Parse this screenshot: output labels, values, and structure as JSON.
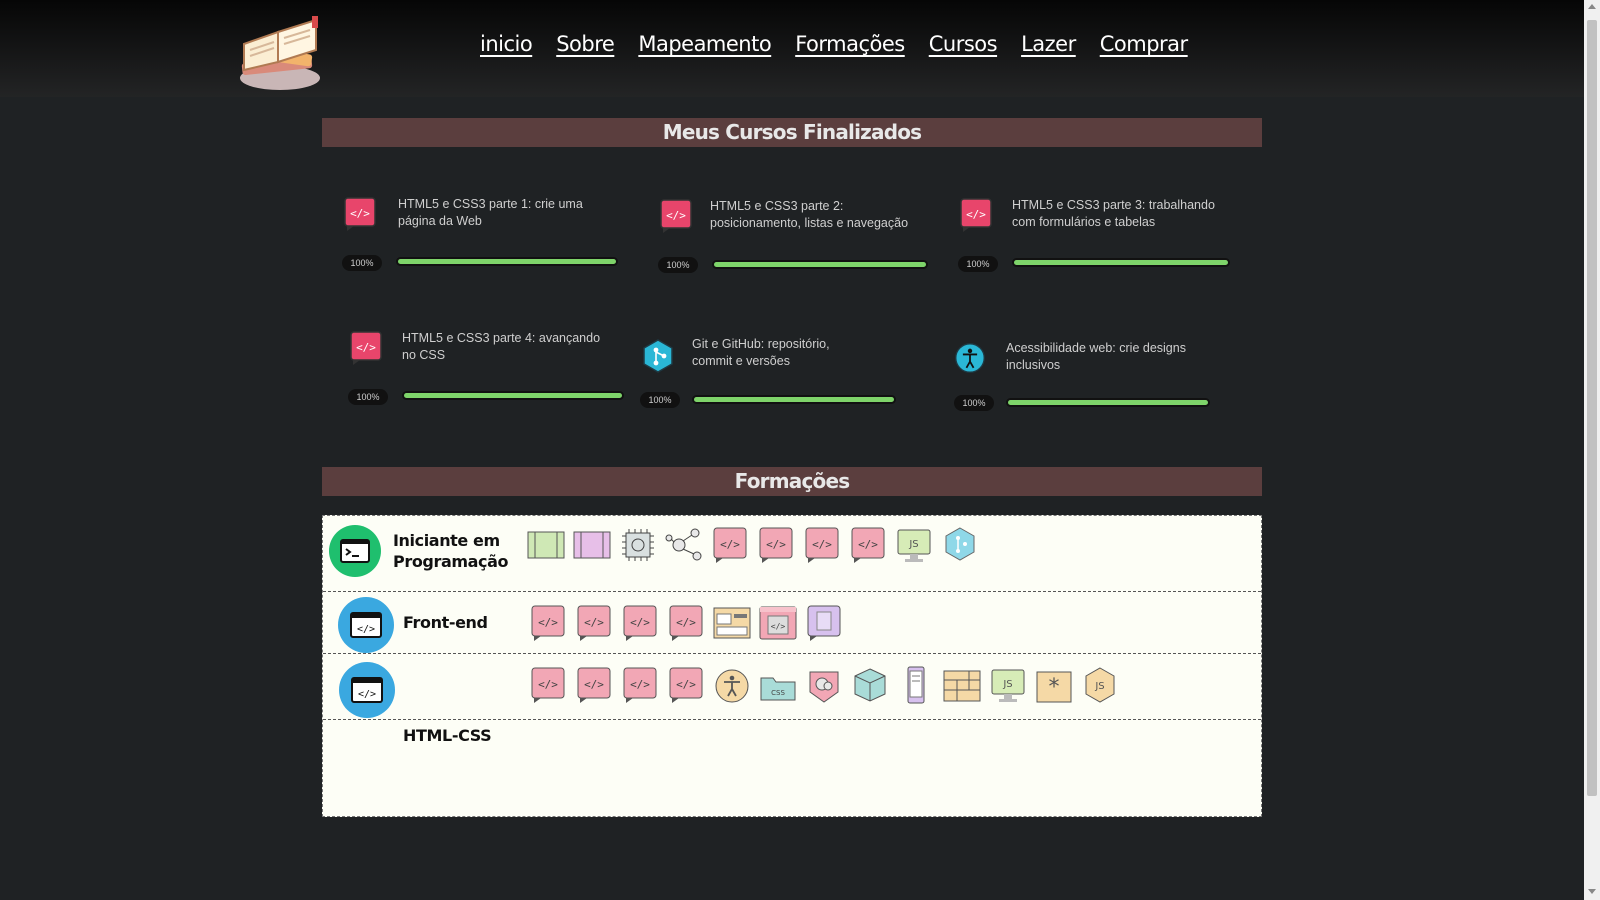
{
  "nav": [
    "inicio",
    "Sobre",
    "Mapeamento",
    "Formações",
    "Cursos",
    "Lazer",
    "Comprar"
  ],
  "sections": {
    "courses_title": "Meus Cursos Finalizados",
    "formations_title": "Formações"
  },
  "courses": [
    {
      "title": "HTML5 e CSS3 parte 1: crie uma página da Web",
      "progress_label": "100%",
      "progress": 1.0,
      "icon": "html-code-icon"
    },
    {
      "title": "HTML5 e CSS3 parte 2: posicionamento, listas e navegação",
      "progress_label": "100%",
      "progress": 1.0,
      "icon": "html-code-icon"
    },
    {
      "title": "HTML5 e CSS3 parte 3: trabalhando com formulários e tabelas",
      "progress_label": "100%",
      "progress": 1.0,
      "icon": "html-code-icon"
    },
    {
      "title": "HTML5 e CSS3 parte 4: avançando no CSS",
      "progress_label": "100%",
      "progress": 1.0,
      "icon": "html-code-icon"
    },
    {
      "title": "Git e GitHub: repositório, commit e versões",
      "progress_label": "100%",
      "progress": 1.0,
      "icon": "git-icon"
    },
    {
      "title": "Acessibilidade web: crie designs inclusivos",
      "progress_label": "100%",
      "progress": 1.0,
      "icon": "accessibility-icon"
    }
  ],
  "formations": [
    {
      "name": "Iniciante em Programação",
      "icon": "terminal-icon",
      "color": "#1fbf6e"
    },
    {
      "name": "Front-end",
      "icon": "browser-code-icon",
      "color": "#3aa8e0"
    },
    {
      "name": "HTML-CSS",
      "icon": "browser-code-icon",
      "color": "#3aa8e0"
    }
  ],
  "colors": {
    "banner": "#5b3e3e",
    "progress_fill": "#7ed46a",
    "html_badge": "#e8456b",
    "git_badge": "#2ab7d6"
  }
}
